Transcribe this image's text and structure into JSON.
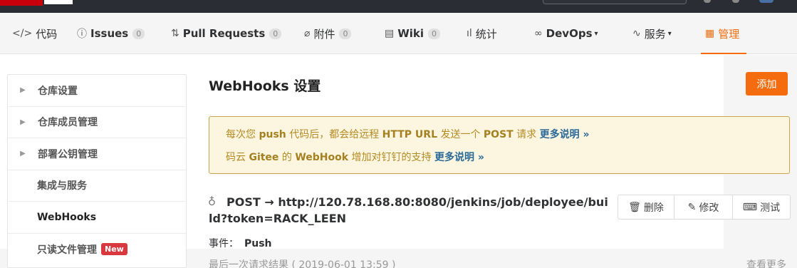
{
  "tabs": [
    {
      "icon": "</>",
      "label": "代码",
      "count": ""
    },
    {
      "icon": "ⓘ",
      "label": "Issues",
      "count": "0"
    },
    {
      "icon": "⇅",
      "label": "Pull Requests",
      "count": "0"
    },
    {
      "icon": "⌀",
      "label": "附件",
      "count": "0"
    },
    {
      "icon": "▤",
      "label": "Wiki",
      "count": "0"
    },
    {
      "icon": "ıl",
      "label": "统计",
      "count": ""
    },
    {
      "icon": "∞",
      "label": "DevOps",
      "count": ""
    },
    {
      "icon": "∿",
      "label": "服务",
      "count": ""
    },
    {
      "icon": "▦",
      "label": "管理",
      "count": ""
    }
  ],
  "accent_color": "#f56c0f",
  "sidebar": {
    "items": [
      {
        "label": "仓库设置"
      },
      {
        "label": "仓库成员管理"
      },
      {
        "label": "部署公钥管理"
      },
      {
        "label": "集成与服务"
      },
      {
        "label": "WebHooks"
      },
      {
        "label": "只读文件管理",
        "badge": "New"
      }
    ]
  },
  "page": {
    "title": "WebHooks 设置",
    "add_label": "添加"
  },
  "notice": {
    "line1_a": "每次您 ",
    "line1_b": "push",
    "line1_c": " 代码后，都会给远程 ",
    "line1_d": "HTTP URL",
    "line1_e": " 发送一个 ",
    "line1_f": "POST",
    "line1_g": " 请求 ",
    "line1_more": "更多说明 »",
    "line2_a": "码云 ",
    "line2_b": "Gitee",
    "line2_c": " 的 ",
    "line2_d": "WebHook",
    "line2_e": " 增加对钉钉的支持 ",
    "line2_more": "更多说明 »"
  },
  "hook": {
    "url": "POST → http://120.78.168.80:8080/jenkins/job/deployee/build?token=RACK_LEEN",
    "event_label": "事件：",
    "event_value": "Push",
    "last_result": "最后一次请求结果 ( 2019-06-01 13:59 )",
    "view_more": "查看更多",
    "delete_label": "删除",
    "edit_label": "修改",
    "test_label": "测试"
  }
}
